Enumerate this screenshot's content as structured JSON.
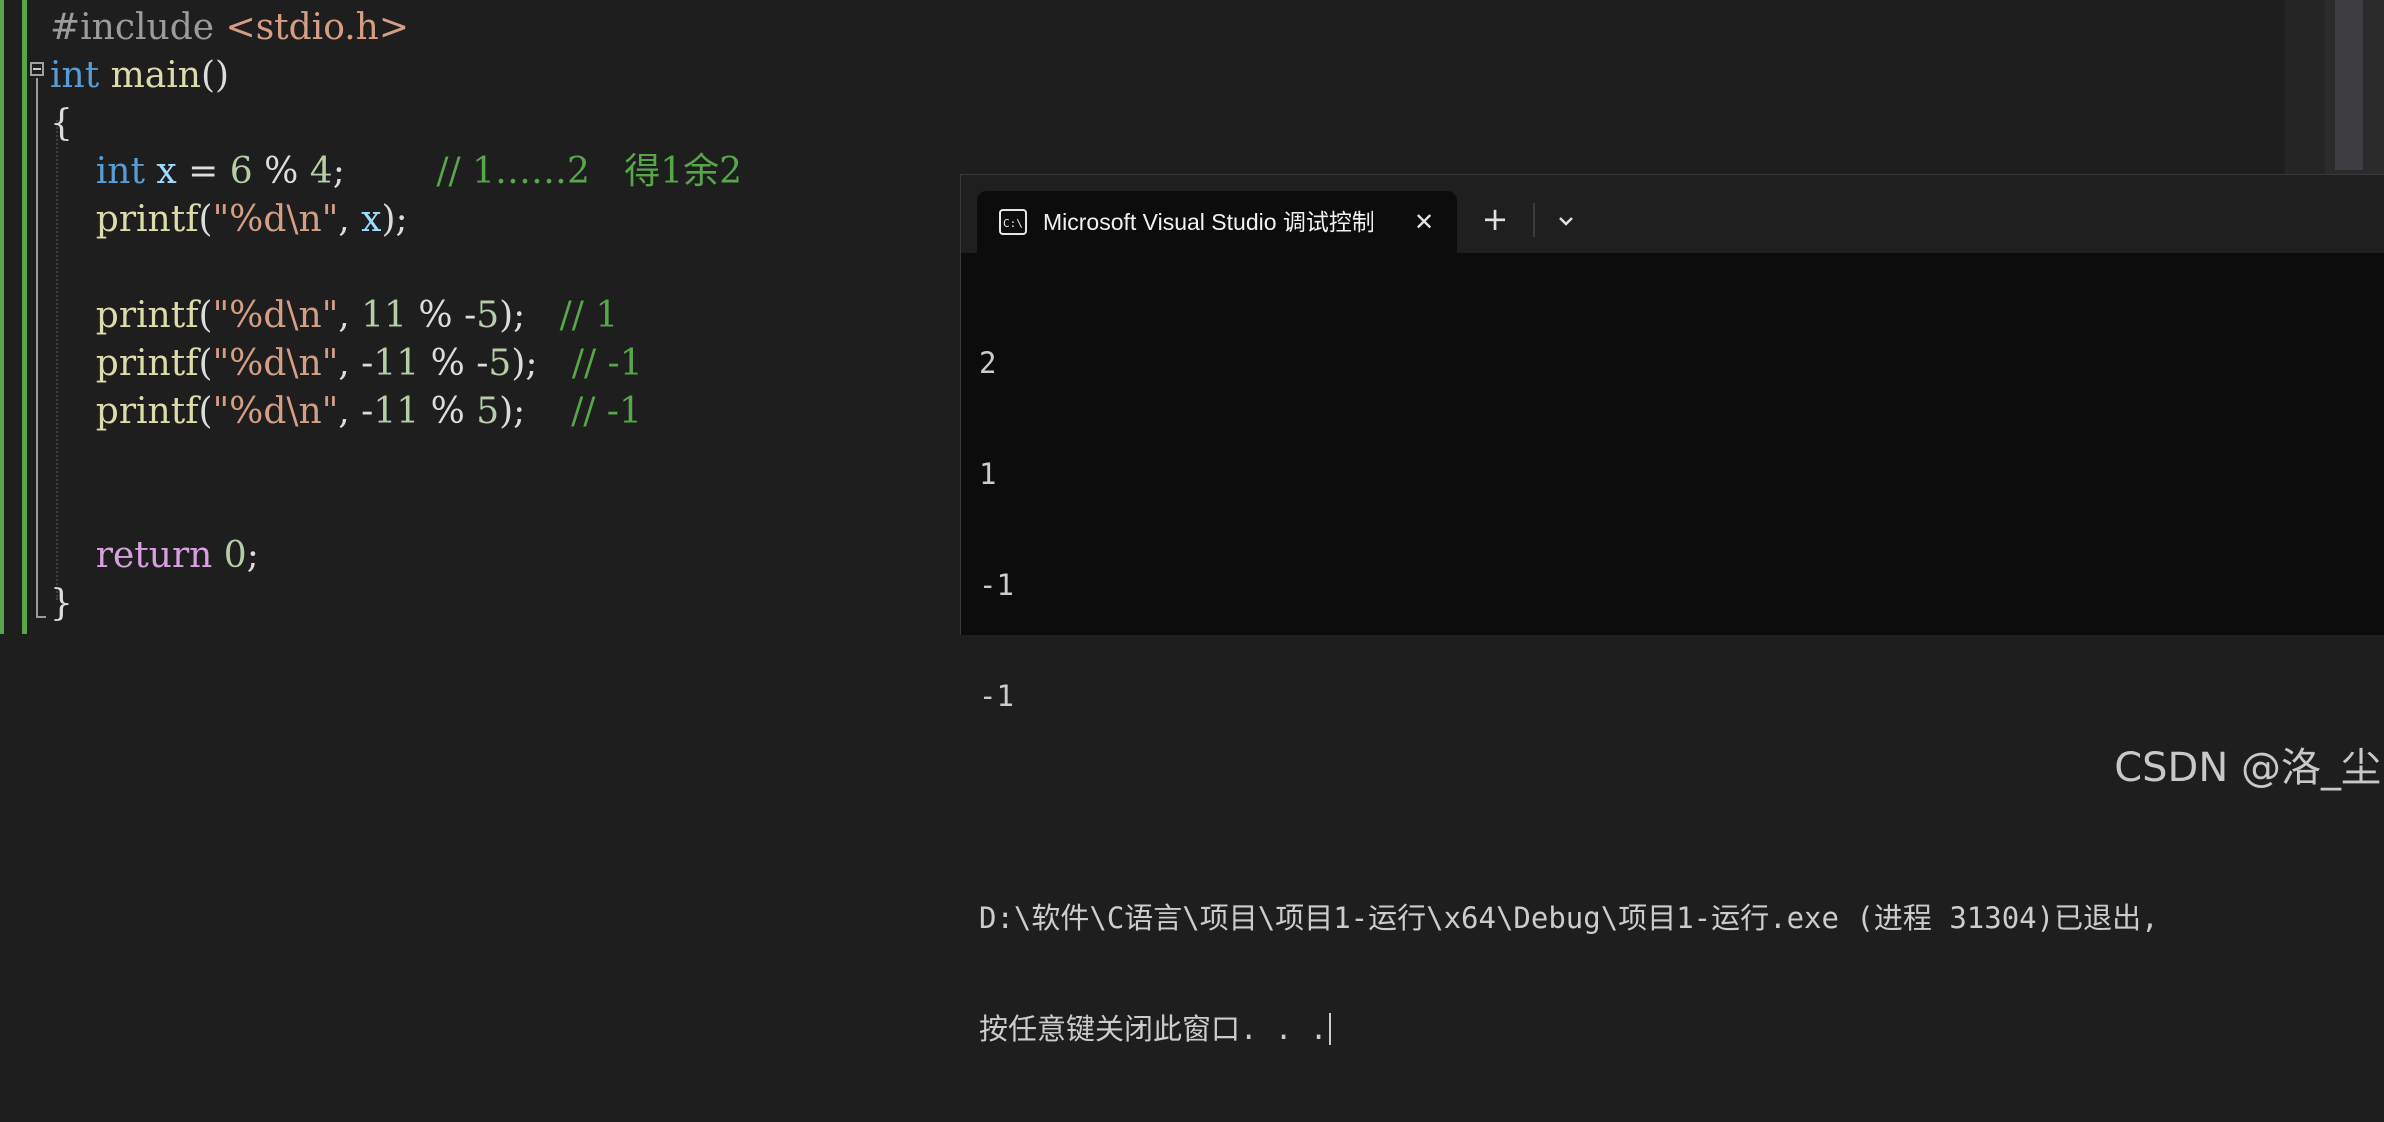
{
  "editor": {
    "lines": [
      {
        "id": "include",
        "segments": [
          {
            "c": "pre",
            "t": "#include "
          },
          {
            "c": "inc",
            "t": "<stdio.h>"
          }
        ]
      },
      {
        "id": "main-sig",
        "segments": [
          {
            "c": "kw",
            "t": "int"
          },
          {
            "c": "pun",
            "t": " "
          },
          {
            "c": "fn",
            "t": "main"
          },
          {
            "c": "pun",
            "t": "()"
          }
        ]
      },
      {
        "id": "open-brace",
        "segments": [
          {
            "c": "pun",
            "t": "{"
          }
        ]
      },
      {
        "id": "decl-x",
        "segments": [
          {
            "c": "pun",
            "t": "    "
          },
          {
            "c": "kw",
            "t": "int"
          },
          {
            "c": "pun",
            "t": " "
          },
          {
            "c": "var",
            "t": "x"
          },
          {
            "c": "pun",
            "t": " = "
          },
          {
            "c": "num",
            "t": "6"
          },
          {
            "c": "pun",
            "t": " % "
          },
          {
            "c": "num",
            "t": "4"
          },
          {
            "c": "pun",
            "t": ";"
          },
          {
            "c": "pun",
            "t": "        "
          },
          {
            "c": "cmt",
            "t": "// 1……2   得1余2"
          }
        ]
      },
      {
        "id": "printf-x",
        "segments": [
          {
            "c": "pun",
            "t": "    "
          },
          {
            "c": "fn",
            "t": "printf"
          },
          {
            "c": "pun",
            "t": "("
          },
          {
            "c": "str",
            "t": "\"%d\\n\""
          },
          {
            "c": "pun",
            "t": ", "
          },
          {
            "c": "var",
            "t": "x"
          },
          {
            "c": "pun",
            "t": ");"
          }
        ]
      },
      {
        "id": "blank-1",
        "segments": []
      },
      {
        "id": "printf-11-neg5",
        "segments": [
          {
            "c": "pun",
            "t": "    "
          },
          {
            "c": "fn",
            "t": "printf"
          },
          {
            "c": "pun",
            "t": "("
          },
          {
            "c": "str",
            "t": "\"%d\\n\""
          },
          {
            "c": "pun",
            "t": ", "
          },
          {
            "c": "num",
            "t": "11"
          },
          {
            "c": "pun",
            "t": " % "
          },
          {
            "c": "pun",
            "t": "-"
          },
          {
            "c": "num",
            "t": "5"
          },
          {
            "c": "pun",
            "t": ");   "
          },
          {
            "c": "cmt",
            "t": "// 1"
          }
        ]
      },
      {
        "id": "printf-neg11-neg5",
        "segments": [
          {
            "c": "pun",
            "t": "    "
          },
          {
            "c": "fn",
            "t": "printf"
          },
          {
            "c": "pun",
            "t": "("
          },
          {
            "c": "str",
            "t": "\"%d\\n\""
          },
          {
            "c": "pun",
            "t": ", "
          },
          {
            "c": "pun",
            "t": "-"
          },
          {
            "c": "num",
            "t": "11"
          },
          {
            "c": "pun",
            "t": " % "
          },
          {
            "c": "pun",
            "t": "-"
          },
          {
            "c": "num",
            "t": "5"
          },
          {
            "c": "pun",
            "t": ");   "
          },
          {
            "c": "cmt",
            "t": "// -1"
          }
        ]
      },
      {
        "id": "printf-neg11-5",
        "segments": [
          {
            "c": "pun",
            "t": "    "
          },
          {
            "c": "fn",
            "t": "printf"
          },
          {
            "c": "pun",
            "t": "("
          },
          {
            "c": "str",
            "t": "\"%d\\n\""
          },
          {
            "c": "pun",
            "t": ", "
          },
          {
            "c": "pun",
            "t": "-"
          },
          {
            "c": "num",
            "t": "11"
          },
          {
            "c": "pun",
            "t": " % "
          },
          {
            "c": "num",
            "t": "5"
          },
          {
            "c": "pun",
            "t": ");    "
          },
          {
            "c": "cmt",
            "t": "// -1"
          }
        ]
      },
      {
        "id": "blank-2",
        "segments": []
      },
      {
        "id": "blank-3",
        "segments": []
      },
      {
        "id": "return",
        "segments": [
          {
            "c": "pun",
            "t": "    "
          },
          {
            "c": "ctl",
            "t": "return"
          },
          {
            "c": "pun",
            "t": " "
          },
          {
            "c": "num",
            "t": "0"
          },
          {
            "c": "pun",
            "t": ";"
          }
        ]
      },
      {
        "id": "close-brace",
        "segments": [
          {
            "c": "pun",
            "t": "}"
          }
        ]
      }
    ]
  },
  "terminal": {
    "tab_title": "Microsoft Visual Studio 调试控制台",
    "tab_icon": "console-icon",
    "close_icon_glyph": "✕",
    "new_tab_glyph": "+",
    "dropdown_icon": "chevron-down-icon",
    "output": [
      "2",
      "1",
      "-1",
      "-1",
      "",
      "D:\\软件\\C语言\\项目\\项目1-运行\\x64\\Debug\\项目1-运行.exe (进程 31304)已退出,",
      "按任意键关闭此窗口. . ."
    ]
  },
  "watermark": "CSDN @洛_尘",
  "colors": {
    "editor_bg": "#1e1e1e",
    "terminal_bg": "#0c0c0c",
    "keyword": "#569cd6",
    "function": "#dcdcaa",
    "string": "#d69d85",
    "number": "#b5cea8",
    "comment": "#57a64a",
    "change_bar": "#57a64a"
  }
}
